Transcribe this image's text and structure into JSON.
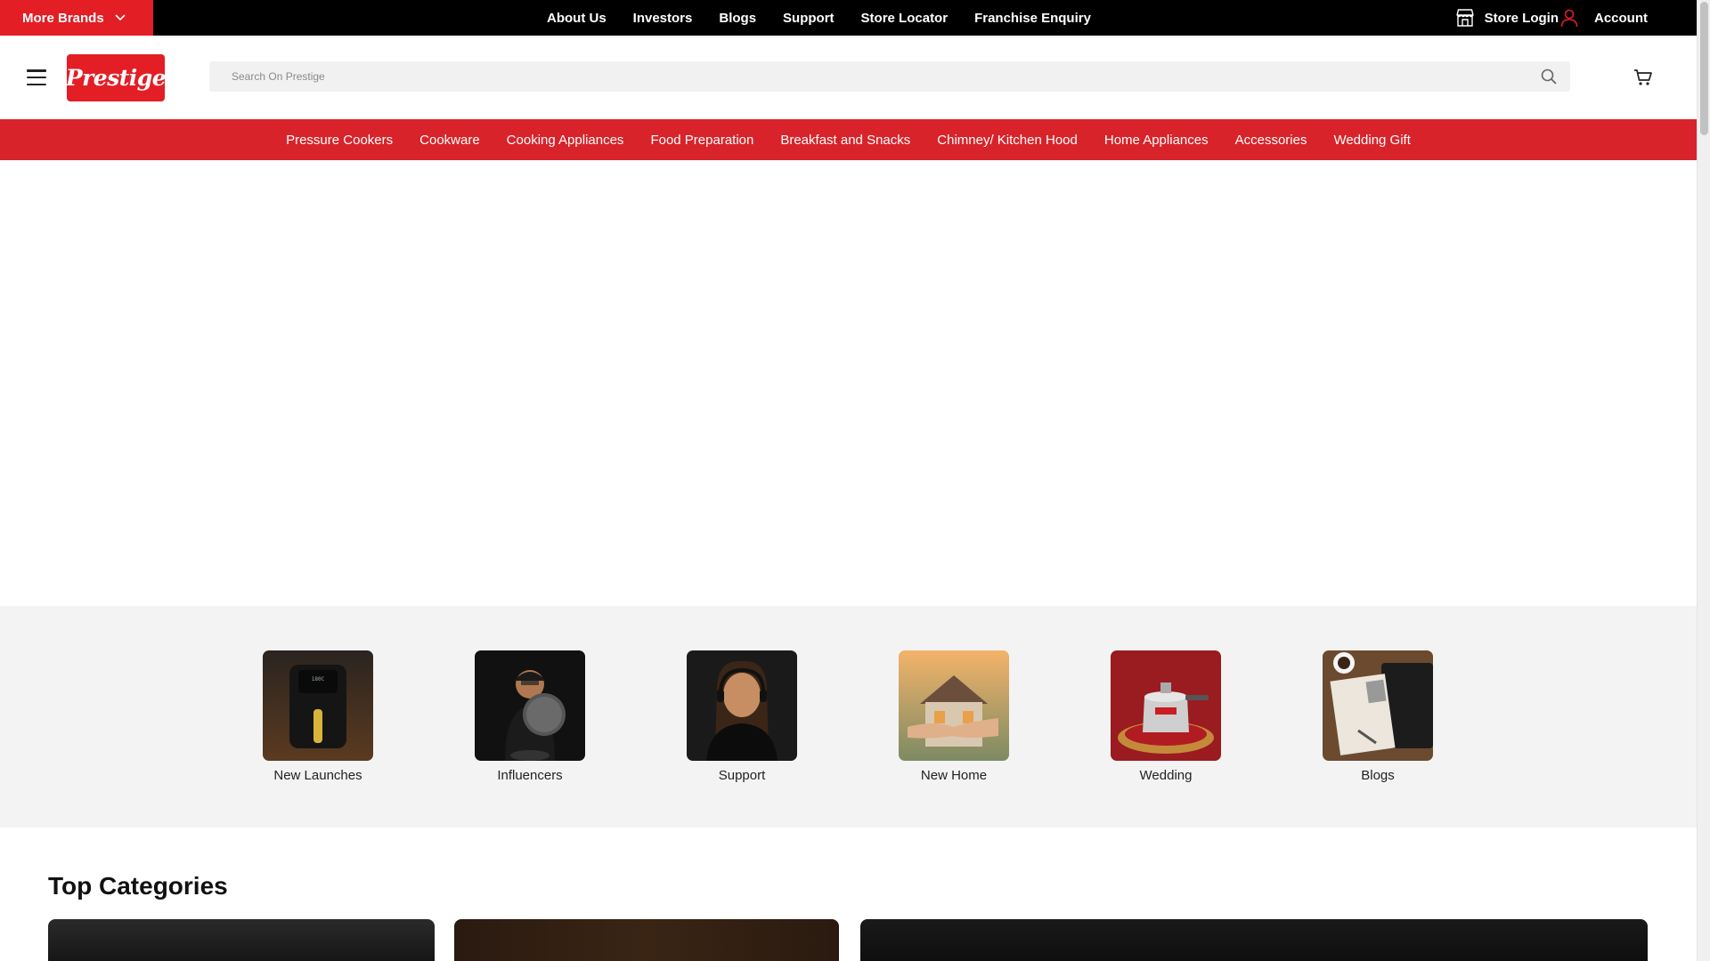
{
  "topbar": {
    "more_brands_label": "More Brands",
    "links": [
      "About Us",
      "Investors",
      "Blogs",
      "Support",
      "Store Locator",
      "Franchise Enquiry"
    ],
    "store_login_label": "Store Login",
    "account_label": "Account"
  },
  "header": {
    "logo_text": "Prestige",
    "search_placeholder": "Search On Prestige"
  },
  "nav": {
    "items": [
      "Pressure Cookers",
      "Cookware",
      "Cooking Appliances",
      "Food Preparation",
      "Breakfast and Snacks",
      "Chimney/ Kitchen Hood",
      "Home Appliances",
      "Accessories",
      "Wedding Gift"
    ]
  },
  "quick_links": {
    "items": [
      "New Launches",
      "Influencers",
      "Support",
      "New Home",
      "Wedding",
      "Blogs"
    ]
  },
  "top_categories": {
    "title": "Top Categories"
  },
  "colors": {
    "brand_red": "#e31e24",
    "nav_red": "#d8232a",
    "top_bar": "#000000"
  },
  "icons": [
    "chevron-down-icon",
    "store-icon",
    "user-icon",
    "hamburger-icon",
    "search-icon",
    "cart-icon"
  ]
}
